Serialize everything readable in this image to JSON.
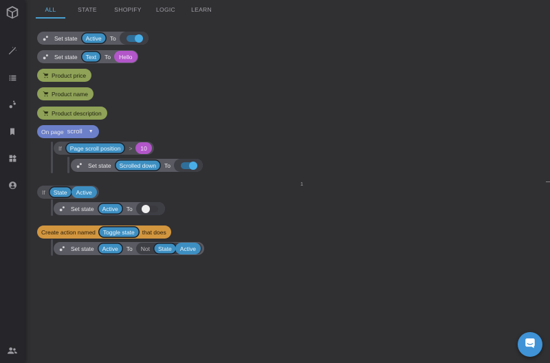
{
  "tabs": [
    {
      "label": "ALL",
      "active": true
    },
    {
      "label": "STATE"
    },
    {
      "label": "SHOPIFY"
    },
    {
      "label": "LOGIC"
    },
    {
      "label": "LEARN"
    }
  ],
  "sidebar_icons": [
    "cube-icon",
    "magic-wand-icon",
    "list-icon",
    "nodes-icon",
    "bookmark-icon",
    "widgets-icon",
    "account-icon",
    "team-icon"
  ],
  "blocks": {
    "set_state_active": {
      "label": "Set state",
      "var": "Active",
      "to": "To",
      "toggle": "on"
    },
    "set_state_text": {
      "label": "Set state",
      "var": "Text",
      "to": "To",
      "value": "Hello"
    },
    "product_price": {
      "label": "Product price"
    },
    "product_name": {
      "label": "Product name"
    },
    "product_description": {
      "label": "Product description"
    },
    "on_page": {
      "label": "On page",
      "event": "scroll"
    },
    "if_scroll": {
      "if": "If",
      "prop": "Page scroll position",
      "op": ">",
      "value": "10"
    },
    "set_scrolled": {
      "label": "Set state",
      "var": "Scrolled down",
      "to": "To",
      "toggle": "on"
    },
    "if_state": {
      "if": "If",
      "prop": "State",
      "value": "Active"
    },
    "set_active_off": {
      "label": "Set state",
      "var": "Active",
      "to": "To",
      "toggle": "off"
    },
    "create_action": {
      "prefix": "Create action named",
      "name": "Toggle state",
      "suffix": "that does"
    },
    "set_active_not": {
      "label": "Set state",
      "var": "Active",
      "to": "To",
      "not": "Not",
      "state": "State",
      "value": "Active"
    }
  },
  "canvas_marker": "1",
  "colors": {
    "accent": "#4aa0d0",
    "background": "#303033",
    "olive": "#8fa257",
    "purple": "#b256c9",
    "orange": "#d2963f",
    "event_blue": "#6c7fc9"
  }
}
